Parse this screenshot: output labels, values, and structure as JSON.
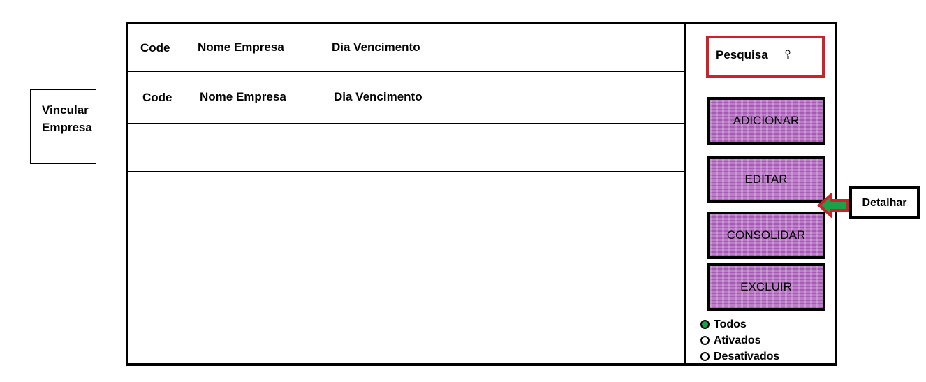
{
  "left_panel": {
    "vincular_line1": "Vincular",
    "vincular_line2": "Empresa"
  },
  "table": {
    "header": {
      "code": "Code",
      "nome_empresa": "Nome Empresa",
      "dia_vencimento": "Dia Vencimento"
    },
    "rows": [
      {
        "code": "Code",
        "nome_empresa": "Nome Empresa",
        "dia_vencimento": "Dia Vencimento"
      }
    ]
  },
  "side_panel": {
    "search_label": "Pesquisa",
    "buttons": {
      "adicionar": "ADICIONAR",
      "editar": "EDITAR",
      "consolidar": "CONSOLIDAR",
      "excluir": "EXCLUIR"
    },
    "filter": {
      "options": [
        "Todos",
        "Ativados",
        "Desativados"
      ],
      "selected": "Todos"
    }
  },
  "detalhar": {
    "label": "Detalhar"
  },
  "colors": {
    "button_fill": "#b46cc2",
    "search_border": "#d0202a",
    "radio_selected": "#19a24a",
    "arrow_fill": "#19a24a",
    "arrow_border": "#d0202a"
  },
  "icons": {
    "search": "key-icon",
    "detalhar_pointer": "arrow-left-icon"
  }
}
